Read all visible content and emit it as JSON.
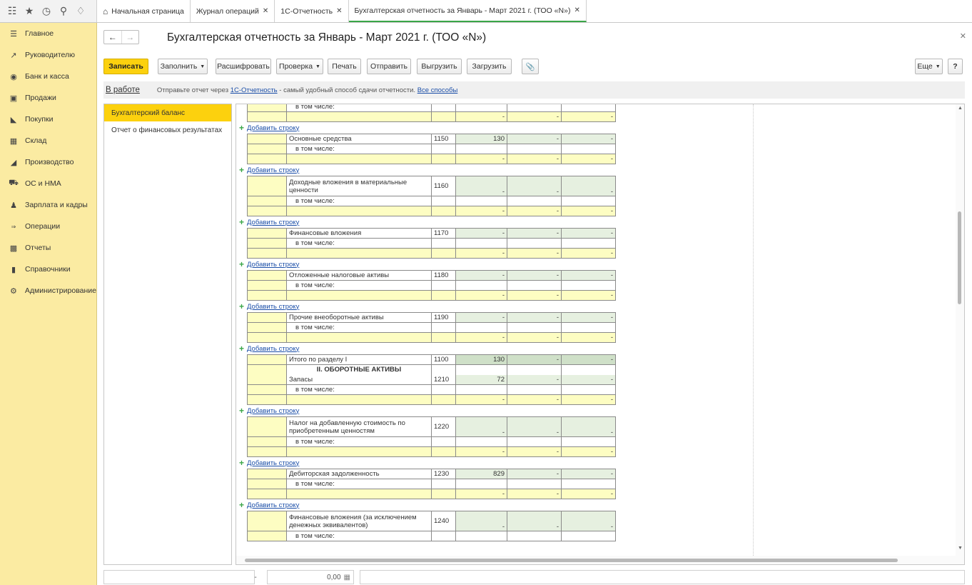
{
  "topbar": {
    "icons": [
      "apps-grid-icon",
      "star-icon",
      "history-icon",
      "search-icon",
      "bell-icon"
    ],
    "tabs": [
      {
        "label": "Начальная страница",
        "closable": false,
        "home": true
      },
      {
        "label": "Журнал операций",
        "closable": true
      },
      {
        "label": "1С-Отчетность",
        "closable": true
      },
      {
        "label": "Бухгалтерская отчетность за Январь - Март 2021 г. (ТОО «N»)",
        "closable": true,
        "active": true
      }
    ]
  },
  "sidebar": {
    "items": [
      {
        "label": "Главное",
        "icon": "menu-icon"
      },
      {
        "label": "Руководителю",
        "icon": "chart-line-icon"
      },
      {
        "label": "Банк и касса",
        "icon": "bank-icon"
      },
      {
        "label": "Продажи",
        "icon": "bag-icon"
      },
      {
        "label": "Покупки",
        "icon": "cart-icon"
      },
      {
        "label": "Склад",
        "icon": "warehouse-icon"
      },
      {
        "label": "Производство",
        "icon": "factory-icon"
      },
      {
        "label": "ОС и НМА",
        "icon": "truck-icon"
      },
      {
        "label": "Зарплата и кадры",
        "icon": "person-icon"
      },
      {
        "label": "Операции",
        "icon": "dt-kt-icon"
      },
      {
        "label": "Отчеты",
        "icon": "bar-chart-icon"
      },
      {
        "label": "Справочники",
        "icon": "book-icon"
      },
      {
        "label": "Администрирование",
        "icon": "gear-icon"
      }
    ]
  },
  "document": {
    "title": "Бухгалтерская отчетность за Январь - Март 2021 г. (ТОО «N»)",
    "toolbar": {
      "save": "Записать",
      "fill": "Заполнить",
      "decode": "Расшифровать",
      "check": "Проверка",
      "print": "Печать",
      "send": "Отправить",
      "export": "Выгрузить",
      "import": "Загрузить",
      "more": "Еще",
      "help": "?"
    },
    "status": {
      "state": "В работе",
      "msg_prefix": "Отправьте отчет через ",
      "msg_link": "1С-Отчетность",
      "msg_middle": " - самый удобный способ сдачи отчетности. ",
      "msg_link2": "Все способы"
    },
    "sections": [
      {
        "label": "Бухгалтерский баланс",
        "selected": true
      },
      {
        "label": "Отчет о финансовых результатах",
        "selected": false
      }
    ],
    "add_row_label": "Добавить строку",
    "including_label": "в том числе:",
    "rows": [
      {
        "name": "Основные средства",
        "code": "1150",
        "v1": "130",
        "v2": "-",
        "v3": "-"
      },
      {
        "name": "Доходные вложения в материальные ценности",
        "code": "1160",
        "v1": "-",
        "v2": "-",
        "v3": "-"
      },
      {
        "name": "Финансовые вложения",
        "code": "1170",
        "v1": "-",
        "v2": "-",
        "v3": "-"
      },
      {
        "name": "Отложенные налоговые активы",
        "code": "1180",
        "v1": "-",
        "v2": "-",
        "v3": "-"
      },
      {
        "name": "Прочие внеоборотные активы",
        "code": "1190",
        "v1": "-",
        "v2": "-",
        "v3": "-"
      }
    ],
    "total": {
      "name": "Итого по разделу I",
      "code": "1100",
      "v1": "130",
      "v2": "-",
      "v3": "-"
    },
    "section2_header": "II. ОБОРОТНЫЕ АКТИВЫ",
    "zapasy": {
      "name": "Запасы",
      "code": "1210",
      "v1": "72",
      "v2": "-",
      "v3": "-"
    },
    "rows2": [
      {
        "name": "Налог на добавленную стоимость по приобретенным ценностям",
        "code": "1220",
        "v1": "-",
        "v2": "-",
        "v3": "-"
      },
      {
        "name": "Дебиторская задолженность",
        "code": "1230",
        "v1": "829",
        "v2": "-",
        "v3": "-"
      },
      {
        "name": "Финансовые вложения (за исключением денежных эквивалентов)",
        "code": "1240",
        "v1": "-",
        "v2": "-",
        "v3": "-"
      }
    ],
    "bottom": {
      "dash": "-",
      "amount": "0,00"
    }
  }
}
